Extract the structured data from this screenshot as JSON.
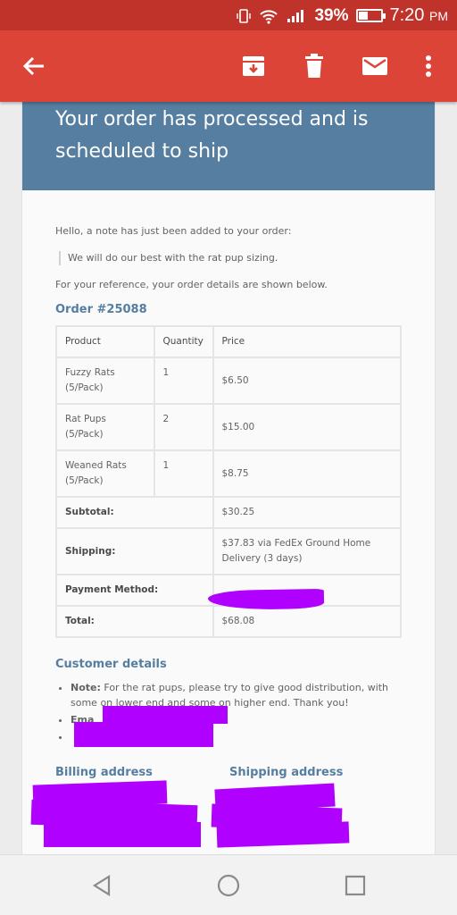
{
  "status_bar": {
    "battery": "39%",
    "battery_level": 0.39,
    "time": "7:20",
    "ampm": "PM"
  },
  "app_bar": {
    "icons": [
      "back-arrow-icon",
      "archive-icon",
      "delete-icon",
      "mail-icon",
      "more-vert-icon"
    ]
  },
  "email": {
    "hero_title": "Your order has processed and is scheduled to ship",
    "greeting": "Hello, a note has just been added to your order:",
    "note": "We will do our best with the rat pup sizing.",
    "reference": "For your reference, your order details are shown below.",
    "order_heading": "Order #25088",
    "table": {
      "headers": [
        "Product",
        "Quantity",
        "Price"
      ],
      "rows": [
        {
          "product": "Fuzzy Rats",
          "variant": "(5/Pack)",
          "quantity": "1",
          "price": "$6.50"
        },
        {
          "product": "Rat Pups",
          "variant": "(5/Pack)",
          "quantity": "2",
          "price": "$15.00"
        },
        {
          "product": "Weaned Rats",
          "variant": "(5/Pack)",
          "quantity": "1",
          "price": "$8.75"
        }
      ],
      "totals": [
        {
          "label": "Subtotal:",
          "value": "$30.25"
        },
        {
          "label": "Shipping:",
          "value": "$37.83 via FedEx Ground Home Delivery (3 days)"
        },
        {
          "label": "Payment Method:",
          "value": ""
        },
        {
          "label": "Total:",
          "value": "$68.08"
        }
      ]
    },
    "customer_heading": "Customer details",
    "customer_note_label": "Note:",
    "customer_note_text": "For the rat pups, please try to give good distribution, with some on lower end and some on higher end. Thank you!",
    "email_label": "Ema",
    "billing_heading": "Billing address",
    "shipping_heading": "Shipping address"
  },
  "colors": {
    "status_bar": "#c0332a",
    "app_bar": "#db4437",
    "hero": "#557ea1",
    "redaction": "#b000ff"
  }
}
